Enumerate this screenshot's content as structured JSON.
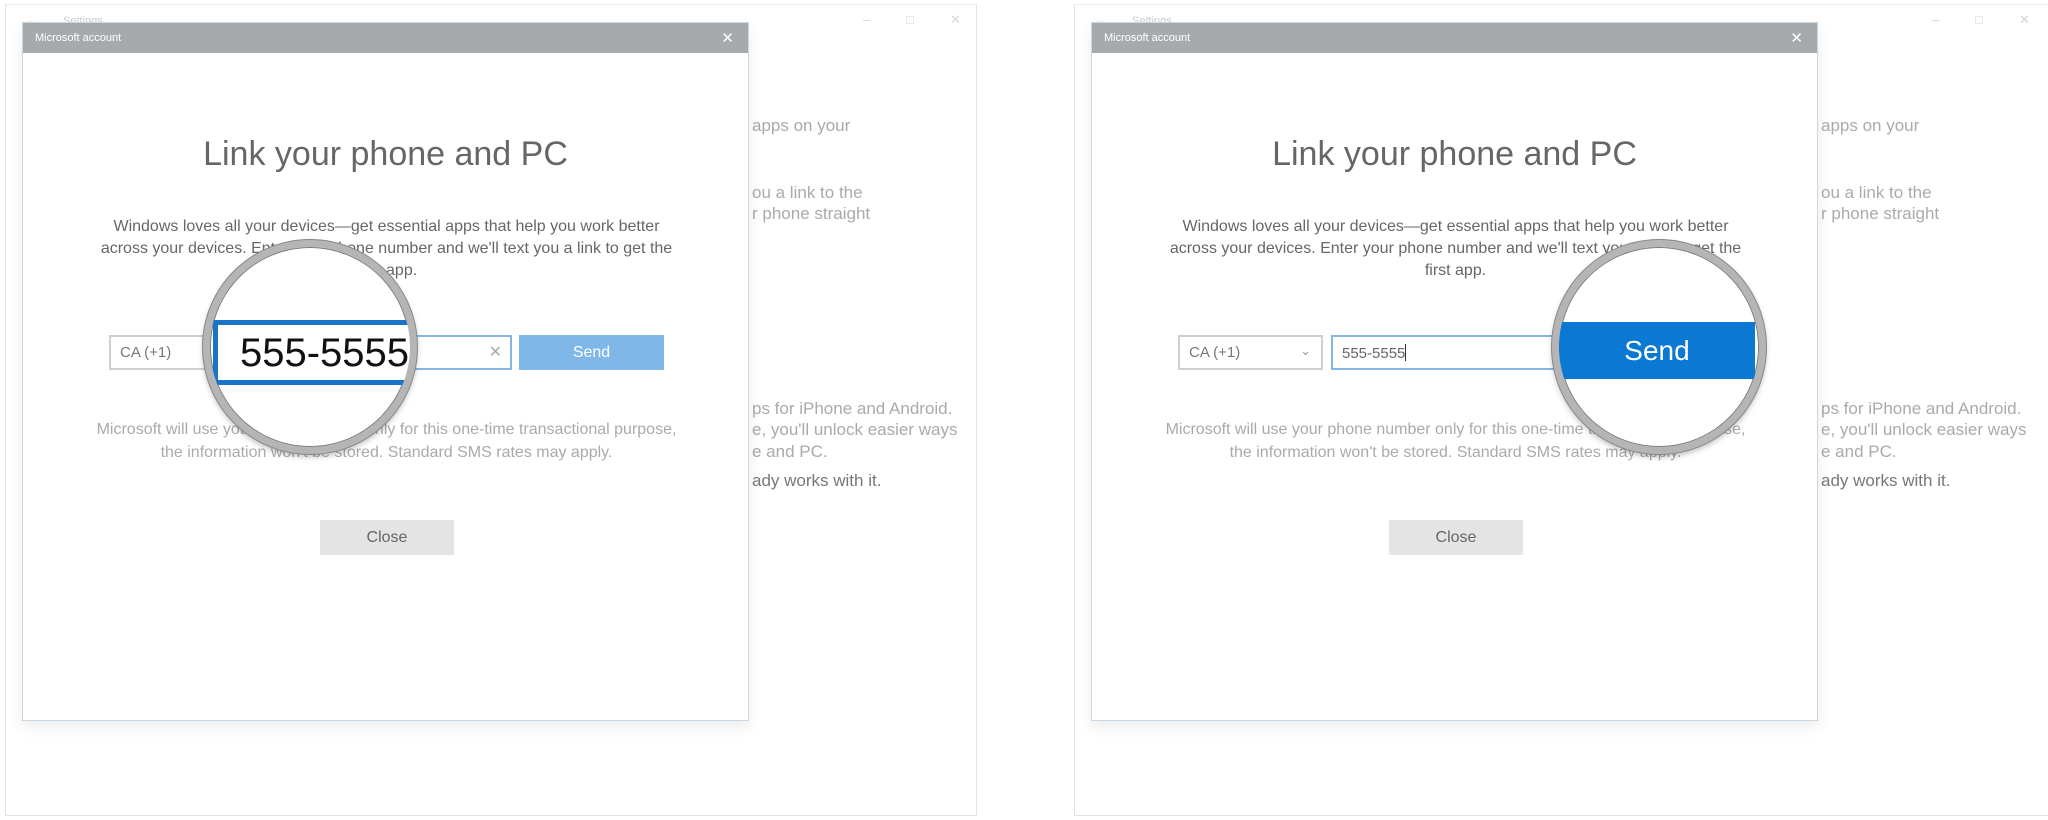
{
  "settings_window": {
    "title": "Settings",
    "back_icon": "arrow-left-icon",
    "controls": [
      "minimize-icon",
      "maximize-icon",
      "close-icon"
    ],
    "background_text": [
      "apps on your",
      "ou a link to the",
      "r phone straight",
      "ps for iPhone and Android.",
      "e, you'll unlock easier ways",
      "e and PC.",
      "ady works with it."
    ]
  },
  "dialog": {
    "title": "Microsoft account",
    "heading": "Link your phone and PC",
    "description": "Windows loves all your devices—get essential apps that help you work better across your devices. Enter your phone number and we'll text you a link to get the first app.",
    "country_code": "CA (+1)",
    "phone_value": "555-5555",
    "send_label": "Send",
    "note": "Microsoft will use your phone number only for this one-time transactional purpose, the information won't be stored. Standard SMS rates may apply.",
    "close_label": "Close"
  },
  "colors": {
    "accent": "#0b78d3",
    "send_disabled": "#7fb7e8",
    "title_bar": "#a7aaad"
  }
}
